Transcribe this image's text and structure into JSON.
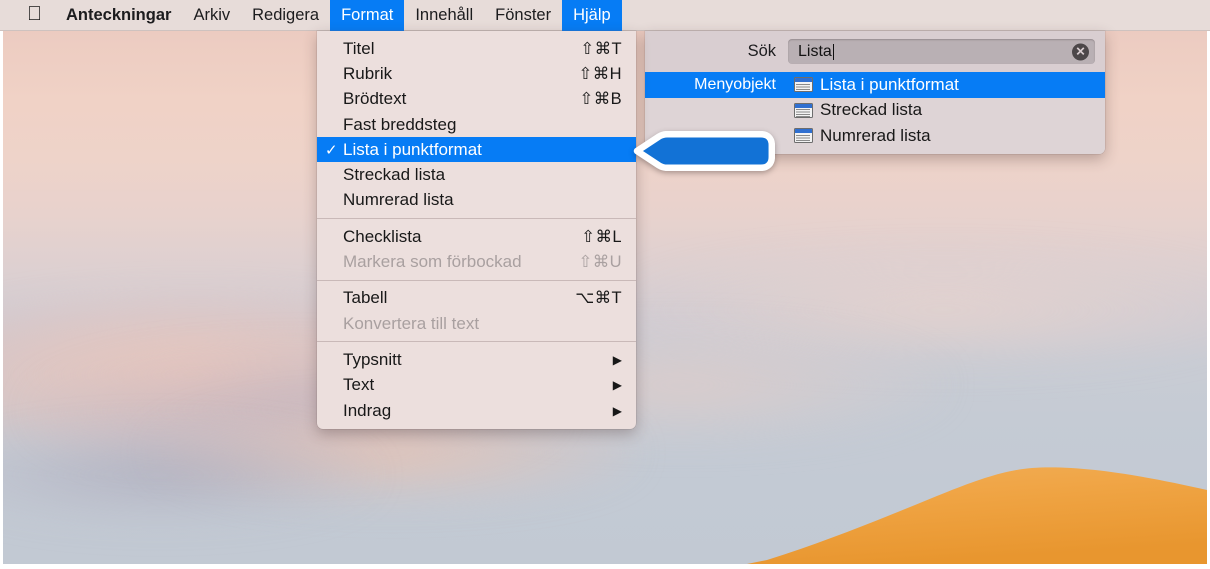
{
  "menubar": {
    "apple_icon": "apple-logo-icon",
    "items": [
      {
        "label": "Anteckningar",
        "active": false,
        "bold": true
      },
      {
        "label": "Arkiv",
        "active": false,
        "bold": false
      },
      {
        "label": "Redigera",
        "active": false,
        "bold": false
      },
      {
        "label": "Format",
        "active": true,
        "bold": false
      },
      {
        "label": "Innehåll",
        "active": false,
        "bold": false
      },
      {
        "label": "Fönster",
        "active": false,
        "bold": false
      },
      {
        "label": "Hjälp",
        "active": true,
        "bold": false
      }
    ]
  },
  "format_menu": {
    "groups": [
      {
        "items": [
          {
            "label": "Titel",
            "shortcut": "⇧⌘T",
            "checked": false,
            "disabled": false,
            "selected": false,
            "submenu": false
          },
          {
            "label": "Rubrik",
            "shortcut": "⇧⌘H",
            "checked": false,
            "disabled": false,
            "selected": false,
            "submenu": false
          },
          {
            "label": "Brödtext",
            "shortcut": "⇧⌘B",
            "checked": false,
            "disabled": false,
            "selected": false,
            "submenu": false
          },
          {
            "label": "Fast breddsteg",
            "shortcut": "",
            "checked": false,
            "disabled": false,
            "selected": false,
            "submenu": false
          },
          {
            "label": "Lista i punktformat",
            "shortcut": "",
            "checked": true,
            "disabled": false,
            "selected": true,
            "submenu": false
          },
          {
            "label": "Streckad lista",
            "shortcut": "",
            "checked": false,
            "disabled": false,
            "selected": false,
            "submenu": false
          },
          {
            "label": "Numrerad lista",
            "shortcut": "",
            "checked": false,
            "disabled": false,
            "selected": false,
            "submenu": false
          }
        ]
      },
      {
        "items": [
          {
            "label": "Checklista",
            "shortcut": "⇧⌘L",
            "checked": false,
            "disabled": false,
            "selected": false,
            "submenu": false
          },
          {
            "label": "Markera som förbockad",
            "shortcut": "⇧⌘U",
            "checked": false,
            "disabled": true,
            "selected": false,
            "submenu": false
          }
        ]
      },
      {
        "items": [
          {
            "label": "Tabell",
            "shortcut": "⌥⌘T",
            "checked": false,
            "disabled": false,
            "selected": false,
            "submenu": false
          },
          {
            "label": "Konvertera till text",
            "shortcut": "",
            "checked": false,
            "disabled": true,
            "selected": false,
            "submenu": false
          }
        ]
      },
      {
        "items": [
          {
            "label": "Typsnitt",
            "shortcut": "",
            "checked": false,
            "disabled": false,
            "selected": false,
            "submenu": true
          },
          {
            "label": "Text",
            "shortcut": "",
            "checked": false,
            "disabled": false,
            "selected": false,
            "submenu": true
          },
          {
            "label": "Indrag",
            "shortcut": "",
            "checked": false,
            "disabled": false,
            "selected": false,
            "submenu": true
          }
        ]
      }
    ],
    "checkmark_glyph": "✓",
    "submenu_glyph": "▶"
  },
  "help_panel": {
    "search_label": "Sök",
    "search_value": "Lista",
    "search_placeholder": "Sök",
    "clear_icon": "clear-circle-icon",
    "clear_glyph": "✕",
    "results": [
      {
        "category": "Menyobjekt",
        "icon": "menu-item-icon",
        "label": "Lista i punktformat",
        "selected": true
      },
      {
        "category": "",
        "icon": "menu-item-icon",
        "label": "Streckad lista",
        "selected": false
      },
      {
        "category": "",
        "icon": "menu-item-icon",
        "label": "Numrerad lista",
        "selected": false
      }
    ]
  },
  "callout": {
    "name": "blue-arrow-pointer",
    "direction": "left",
    "fill": "#1272d6",
    "stroke": "#ffffff"
  },
  "colors": {
    "accent_blue": "#067cf5",
    "menubar_bg": "#e7dcd9",
    "menu_bg": "#ecdfdd",
    "help_bg": "#ded4d6",
    "dune_orange": "#efa13f",
    "sky_top": "#e9c6bd",
    "sky_bottom": "#c2c9d3"
  }
}
